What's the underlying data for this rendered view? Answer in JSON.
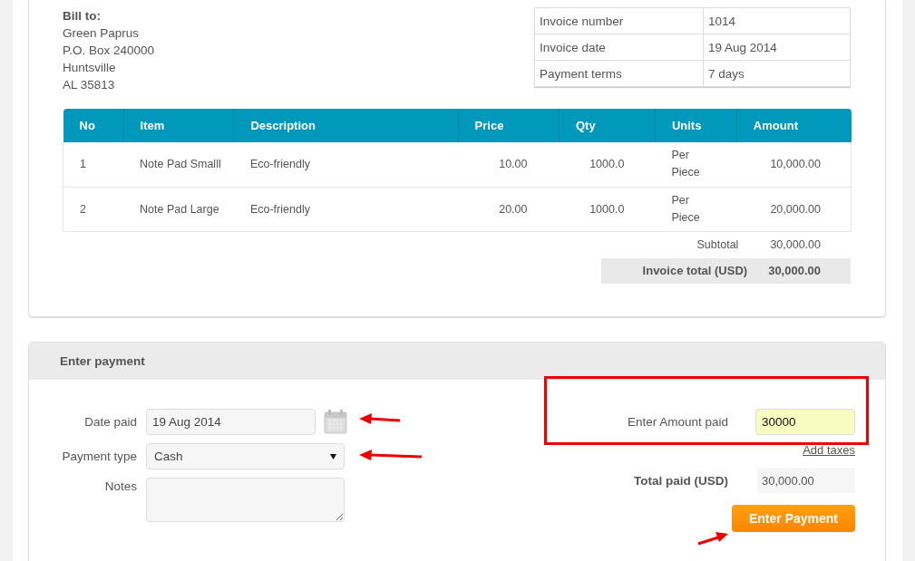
{
  "bill_to": {
    "heading": "Bill to:",
    "lines": [
      "Green Paprus",
      "P.O. Box 240000",
      "Huntsville",
      "AL 35813"
    ]
  },
  "invoice_info": [
    {
      "label": "Invoice number",
      "value": "1014"
    },
    {
      "label": "Invoice date",
      "value": "19 Aug 2014"
    },
    {
      "label": "Payment terms",
      "value": "7 days"
    }
  ],
  "items_table": {
    "columns": [
      "No",
      "Item",
      "Description",
      "Price",
      "Qty",
      "Units",
      "Amount"
    ],
    "rows": [
      [
        "1",
        "Note Pad Smalll",
        "Eco-friendly",
        "10.00",
        "1000.0",
        "Per Piece",
        "10,000.00"
      ],
      [
        "2",
        "Note Pad Large",
        "Eco-friendly",
        "20.00",
        "1000.0",
        "Per Piece",
        "20,000.00"
      ]
    ],
    "subtotal": {
      "label": "Subtotal",
      "value": "30,000.00"
    },
    "total": {
      "label": "Invoice total (USD)",
      "value": "30,000.00"
    }
  },
  "payment": {
    "title": "Enter payment",
    "date_paid": {
      "label": "Date paid",
      "value": "19 Aug 2014"
    },
    "payment_type": {
      "label": "Payment type",
      "value": "Cash"
    },
    "notes": {
      "label": "Notes"
    },
    "amount_paid": {
      "label": "Enter Amount paid",
      "value": "30000"
    },
    "add_taxes": "Add taxes",
    "total_paid": {
      "label": "Total paid (USD)",
      "value": "30,000.00"
    },
    "submit": "Enter Payment"
  }
}
